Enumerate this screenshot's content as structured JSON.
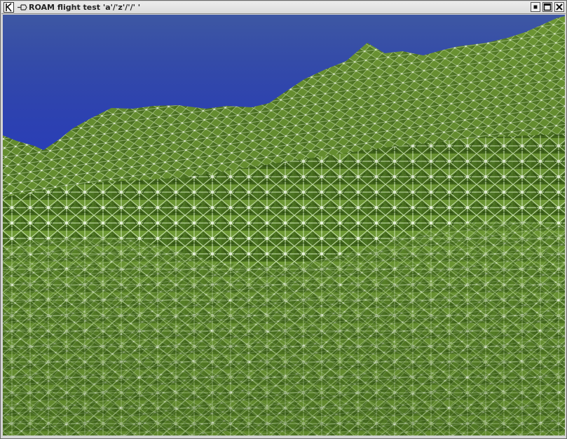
{
  "window": {
    "title": "ROAM flight test 'a'/'z'/'/' '",
    "title_icon": "kde-k-icon",
    "pin_icon": "pin-icon",
    "controls": [
      "minimize-button",
      "maximize-button",
      "close-button"
    ]
  },
  "scene": {
    "sky_color": "#2a3fc6",
    "terrain_base_color": "#5a7d2a",
    "terrain_dark_color": "#1f3a0d",
    "terrain_light_color": "#d8efc0",
    "highlight_color": "#eef9e0"
  }
}
